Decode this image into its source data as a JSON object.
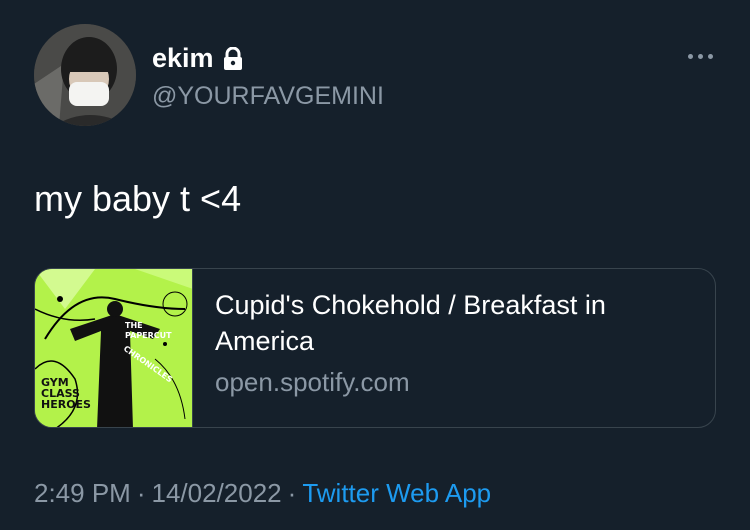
{
  "author": {
    "display_name": "ekim",
    "handle": "@YOURFAVGEMINI",
    "protected_icon": "lock-icon"
  },
  "tweet": {
    "text": "my baby t <4"
  },
  "card": {
    "title": "Cupid's Chokehold / Breakfast in America",
    "domain": "open.spotify.com",
    "image_text": {
      "line1": "THE",
      "line2": "PAPERCUT",
      "line3": "CHRONICLES",
      "logo": "GYM CLASS HEROES"
    }
  },
  "meta": {
    "time": "2:49 PM",
    "separator": "·",
    "date": "14/02/2022",
    "source": "Twitter Web App"
  },
  "colors": {
    "background": "#15202b",
    "secondary_text": "#8b98a5",
    "link": "#1d9bf0",
    "album_green": "#b3f24a"
  }
}
